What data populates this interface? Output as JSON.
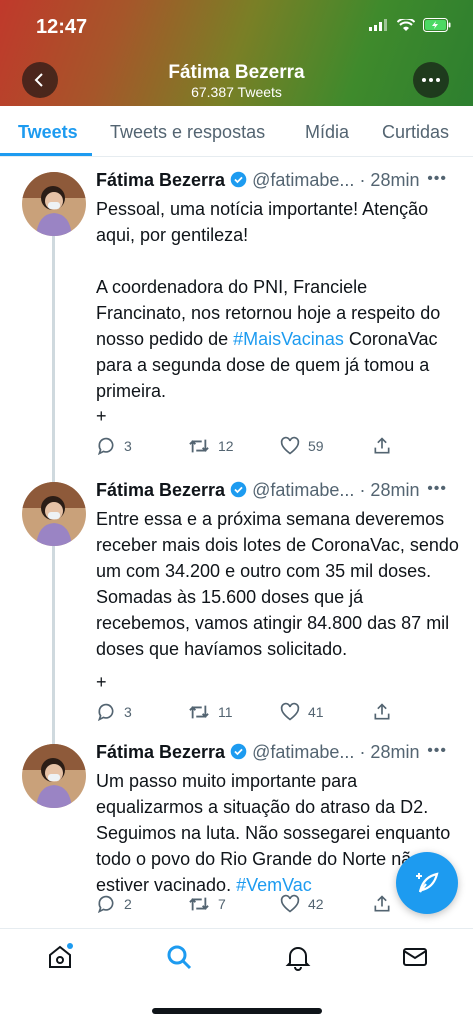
{
  "status_bar": {
    "time": "12:47"
  },
  "header": {
    "name": "Fátima Bezerra",
    "tweet_count": "67.387 Tweets"
  },
  "tabs": [
    {
      "label": "Tweets",
      "active": true
    },
    {
      "label": "Tweets e respostas",
      "active": false
    },
    {
      "label": "Mídia",
      "active": false
    },
    {
      "label": "Curtidas",
      "active": false
    }
  ],
  "tweets": [
    {
      "name": "Fátima Bezerra",
      "handle": "@fatimabe...",
      "time": "· 28min",
      "paragraphs": [
        {
          "parts": [
            {
              "t": "Pessoal, uma notícia importante! Atenção aqui, por gentileza!"
            }
          ]
        },
        {
          "parts": [
            {
              "t": "A coordenadora do PNI, Franciele Francinato, nos retornou hoje a respeito do nosso pedido de "
            },
            {
              "t": "#MaisVacinas",
              "link": true
            },
            {
              "t": " CoronaVac para a segunda dose de quem já tomou a primeira."
            }
          ]
        }
      ],
      "plus": "+",
      "replies": "3",
      "retweets": "12",
      "likes": "59"
    },
    {
      "name": "Fátima Bezerra",
      "handle": "@fatimabe...",
      "time": "· 28min",
      "paragraphs": [
        {
          "parts": [
            {
              "t": "Entre essa e a próxima semana deveremos receber mais dois lotes de CoronaVac, sendo um com 34.200 e outro com 35 mil doses. Somadas às 15.600 doses que já recebemos, vamos atingir 84.800 das 87 mil doses que havíamos solicitado."
            }
          ]
        }
      ],
      "plus": "+",
      "replies": "3",
      "retweets": "11",
      "likes": "41"
    },
    {
      "name": "Fátima Bezerra",
      "handle": "@fatimabe...",
      "time": "· 28min",
      "paragraphs": [
        {
          "parts": [
            {
              "t": "Um passo muito importante para equalizarmos a situação do atraso da D2. Seguimos na luta. Não sossegarei enquanto todo o povo do Rio Grande do Norte não estiver vacinado. "
            },
            {
              "t": "#VemVac",
              "link": true
            }
          ]
        }
      ],
      "plus": "",
      "replies": "2",
      "retweets": "7",
      "likes": "42"
    }
  ],
  "colors": {
    "accent": "#1d9bf0",
    "text": "#0f1419",
    "muted": "#536471"
  }
}
